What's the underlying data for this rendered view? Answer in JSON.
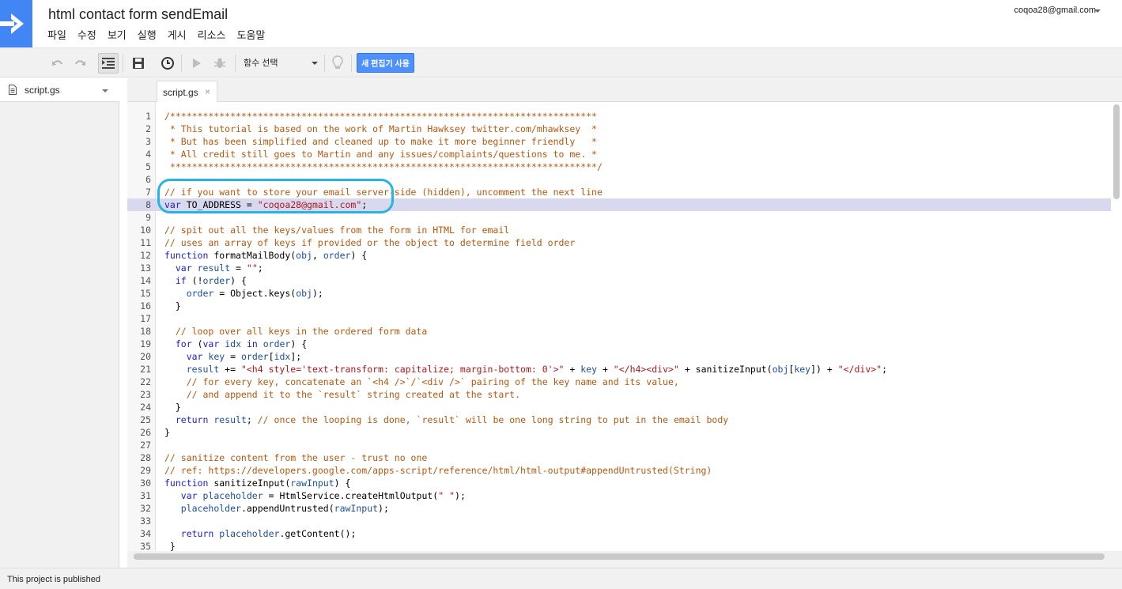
{
  "header": {
    "title": "html contact form sendEmail",
    "account": "coqoa28@gmail.com",
    "menu": [
      "파일",
      "수정",
      "보기",
      "실행",
      "게시",
      "리소스",
      "도움말"
    ]
  },
  "toolbar": {
    "function_select": "함수 선택",
    "new_editor_button": "새 편집기 사용"
  },
  "files": [
    {
      "name": "script.gs"
    }
  ],
  "tab": {
    "label": "script.gs",
    "close": "×"
  },
  "status": {
    "text": "This project is published"
  },
  "colors": {
    "brand_blue": "#4285f4",
    "button_blue": "#4d90fe",
    "highlight_outline": "#27b3e6",
    "active_line_bg": "#d8d8ef",
    "comment": "#b5580f",
    "keyword": "#2020d0",
    "string": "#b0161b",
    "identifier": "#1b4fa0"
  },
  "icons": [
    "apps-script-arrow-icon",
    "undo-icon",
    "redo-icon",
    "indent-icon",
    "save-icon",
    "triggers-clock-icon",
    "run-icon",
    "debug-bug-icon",
    "lightbulb-icon",
    "file-doc-icon",
    "chevron-down-icon"
  ],
  "editor": {
    "active_line": 8,
    "lines": [
      {
        "n": "1",
        "t": [
          [
            "/******************************************************************************",
            "com"
          ]
        ]
      },
      {
        "n": "2",
        "t": [
          [
            " * This tutorial is based on the work of Martin Hawksey twitter.com/mhawksey  *",
            "com"
          ]
        ]
      },
      {
        "n": "3",
        "t": [
          [
            " * But has been simplified and cleaned up to make it more beginner friendly   *",
            "com"
          ]
        ]
      },
      {
        "n": "4",
        "t": [
          [
            " * All credit still goes to Martin and any issues/complaints/questions to me. *",
            "com"
          ]
        ]
      },
      {
        "n": "5",
        "t": [
          [
            " ******************************************************************************/",
            "com"
          ]
        ]
      },
      {
        "n": "6",
        "t": []
      },
      {
        "n": "7",
        "t": [
          [
            "// if you want to store your email server-side (hidden), uncomment the next line",
            "com"
          ]
        ]
      },
      {
        "n": "8",
        "t": [
          [
            "var",
            "kw"
          ],
          [
            " TO_ADDRESS = ",
            ""
          ],
          [
            "\"coqoa28@gmail.com\"",
            "str"
          ],
          [
            ";",
            ""
          ]
        ]
      },
      {
        "n": "9",
        "t": []
      },
      {
        "n": "10",
        "t": [
          [
            "// spit out all the keys/values from the form in HTML for email",
            "com"
          ]
        ]
      },
      {
        "n": "11",
        "t": [
          [
            "// uses an array of keys if provided or the object to determine field order",
            "com"
          ]
        ]
      },
      {
        "n": "12",
        "t": [
          [
            "function",
            "kw"
          ],
          [
            " formatMailBody(",
            ""
          ],
          [
            "obj",
            "var"
          ],
          [
            ", ",
            ""
          ],
          [
            "order",
            "var"
          ],
          [
            ") {",
            ""
          ]
        ]
      },
      {
        "n": "13",
        "t": [
          [
            "  ",
            ""
          ],
          [
            "var",
            "kw"
          ],
          [
            " ",
            ""
          ],
          [
            "result",
            "var"
          ],
          [
            " = ",
            ""
          ],
          [
            "\"\"",
            "str"
          ],
          [
            ";",
            ""
          ]
        ]
      },
      {
        "n": "14",
        "t": [
          [
            "  ",
            ""
          ],
          [
            "if",
            "kw"
          ],
          [
            " (!",
            ""
          ],
          [
            "order",
            "var"
          ],
          [
            ") {",
            ""
          ]
        ]
      },
      {
        "n": "15",
        "t": [
          [
            "    ",
            ""
          ],
          [
            "order",
            "var"
          ],
          [
            " = Object.keys(",
            ""
          ],
          [
            "obj",
            "var"
          ],
          [
            ");",
            ""
          ]
        ]
      },
      {
        "n": "16",
        "t": [
          [
            "  }",
            ""
          ]
        ]
      },
      {
        "n": "17",
        "t": []
      },
      {
        "n": "18",
        "t": [
          [
            "  // loop over all keys in the ordered form data",
            "com"
          ]
        ]
      },
      {
        "n": "19",
        "t": [
          [
            "  ",
            ""
          ],
          [
            "for",
            "kw"
          ],
          [
            " (",
            ""
          ],
          [
            "var",
            "kw"
          ],
          [
            " ",
            ""
          ],
          [
            "idx",
            "var"
          ],
          [
            " ",
            ""
          ],
          [
            "in",
            "kw"
          ],
          [
            " ",
            ""
          ],
          [
            "order",
            "var"
          ],
          [
            ") {",
            ""
          ]
        ]
      },
      {
        "n": "20",
        "t": [
          [
            "    ",
            ""
          ],
          [
            "var",
            "kw"
          ],
          [
            " ",
            ""
          ],
          [
            "key",
            "var"
          ],
          [
            " = ",
            ""
          ],
          [
            "order",
            "var"
          ],
          [
            "[",
            ""
          ],
          [
            "idx",
            "var"
          ],
          [
            "];",
            ""
          ]
        ]
      },
      {
        "n": "21",
        "t": [
          [
            "    ",
            ""
          ],
          [
            "result",
            "var"
          ],
          [
            " += ",
            ""
          ],
          [
            "\"<h4 style='text-transform: capitalize; margin-bottom: 0'>\"",
            "str"
          ],
          [
            " + ",
            ""
          ],
          [
            "key",
            "var"
          ],
          [
            " + ",
            ""
          ],
          [
            "\"</h4><div>\"",
            "str"
          ],
          [
            " + sanitizeInput(",
            ""
          ],
          [
            "obj",
            "var"
          ],
          [
            "[",
            ""
          ],
          [
            "key",
            "var"
          ],
          [
            "]) + ",
            ""
          ],
          [
            "\"</div>\"",
            "str"
          ],
          [
            ";",
            ""
          ]
        ]
      },
      {
        "n": "22",
        "t": [
          [
            "    // for every key, concatenate an `<h4 />`/`<div />` pairing of the key name and its value,",
            "com"
          ]
        ]
      },
      {
        "n": "23",
        "t": [
          [
            "    // and append it to the `result` string created at the start.",
            "com"
          ]
        ]
      },
      {
        "n": "24",
        "t": [
          [
            "  }",
            ""
          ]
        ]
      },
      {
        "n": "25",
        "t": [
          [
            "  ",
            ""
          ],
          [
            "return",
            "kw"
          ],
          [
            " ",
            ""
          ],
          [
            "result",
            "var"
          ],
          [
            "; ",
            ""
          ],
          [
            "// once the looping is done, `result` will be one long string to put in the email body",
            "com"
          ]
        ]
      },
      {
        "n": "26",
        "t": [
          [
            "}",
            ""
          ]
        ]
      },
      {
        "n": "27",
        "t": []
      },
      {
        "n": "28",
        "t": [
          [
            "// sanitize content from the user - trust no one",
            "com"
          ]
        ]
      },
      {
        "n": "29",
        "t": [
          [
            "// ref: https://developers.google.com/apps-script/reference/html/html-output#appendUntrusted(String)",
            "com"
          ]
        ]
      },
      {
        "n": "30",
        "t": [
          [
            "function",
            "kw"
          ],
          [
            " sanitizeInput(",
            ""
          ],
          [
            "rawInput",
            "var"
          ],
          [
            ") {",
            ""
          ]
        ]
      },
      {
        "n": "31",
        "t": [
          [
            "   ",
            ""
          ],
          [
            "var",
            "kw"
          ],
          [
            " ",
            ""
          ],
          [
            "placeholder",
            "var"
          ],
          [
            " = HtmlService.createHtmlOutput(",
            ""
          ],
          [
            "\" \"",
            "str"
          ],
          [
            ");",
            ""
          ]
        ]
      },
      {
        "n": "32",
        "t": [
          [
            "   ",
            ""
          ],
          [
            "placeholder",
            "var"
          ],
          [
            ".appendUntrusted(",
            ""
          ],
          [
            "rawInput",
            "var"
          ],
          [
            ");",
            ""
          ]
        ]
      },
      {
        "n": "33",
        "t": []
      },
      {
        "n": "34",
        "t": [
          [
            "   ",
            ""
          ],
          [
            "return",
            "kw"
          ],
          [
            " ",
            ""
          ],
          [
            "placeholder",
            "var"
          ],
          [
            ".getContent();",
            ""
          ]
        ]
      },
      {
        "n": "35",
        "t": [
          [
            " }",
            ""
          ]
        ]
      }
    ]
  }
}
